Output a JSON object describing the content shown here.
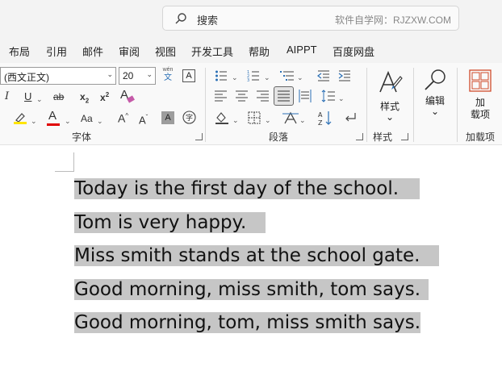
{
  "search": {
    "placeholder": "搜索",
    "watermark": "软件自学网：RJZXW.COM"
  },
  "menu": [
    "布局",
    "引用",
    "邮件",
    "审阅",
    "视图",
    "开发工具",
    "帮助",
    "AIPPT",
    "百度网盘"
  ],
  "font": {
    "name": "(西文正文)",
    "size": "20",
    "wen": "wén",
    "wen_char": "文",
    "a_box": "A"
  },
  "groups": {
    "font": "字体",
    "paragraph": "段落",
    "styles": "样式",
    "addins": "加载项"
  },
  "styles_button": "样式",
  "edit_button": "编辑",
  "addin_button_line1": "加",
  "addin_button_line2": "载项",
  "document": {
    "lines": [
      "Today is the first day of the school.",
      "Tom is very happy.",
      "Miss smith stands at the school gate.",
      "Good morning, miss smith, tom says.",
      "Good morning, tom, miss smith says."
    ]
  },
  "colors": {
    "highlight": "#c6c6c6",
    "highlighter_yellow": "#ffe500",
    "font_red": "#e00000",
    "addin_icon": "#d04a2b"
  }
}
